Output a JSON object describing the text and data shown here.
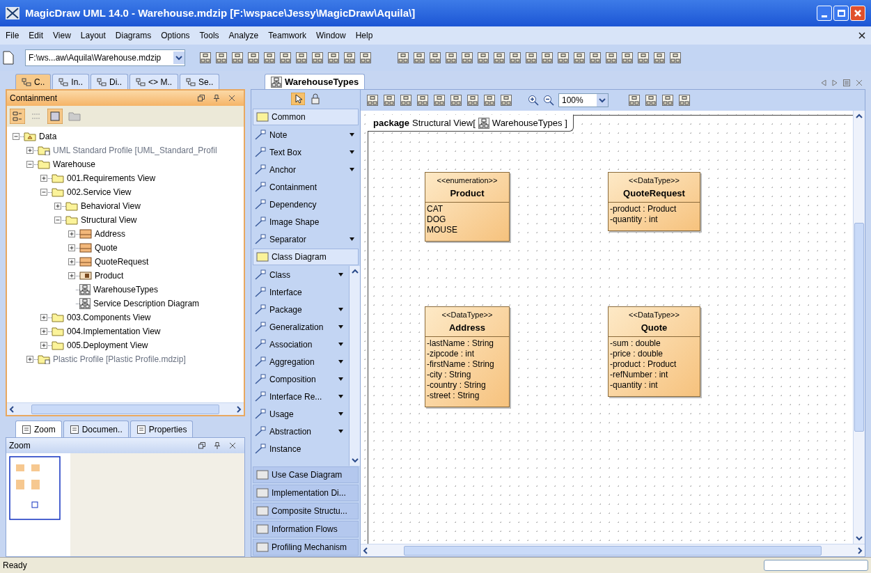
{
  "window": {
    "title": "MagicDraw UML 14.0 - Warehouse.mdzip [F:\\wspace\\Jessy\\MagicDraw\\Aquila\\]"
  },
  "menu": [
    "File",
    "Edit",
    "View",
    "Layout",
    "Diagrams",
    "Options",
    "Tools",
    "Analyze",
    "Teamwork",
    "Window",
    "Help"
  ],
  "toolbar": {
    "project_path": "F:\\ws...aw\\Aquila\\Warehouse.mdzip"
  },
  "browser_tabs": [
    {
      "label": "C..",
      "selected": true
    },
    {
      "label": "In..",
      "selected": false
    },
    {
      "label": "Di..",
      "selected": false
    },
    {
      "label": "<> M..",
      "selected": false
    },
    {
      "label": "Se..",
      "selected": false
    }
  ],
  "containment": {
    "title": "Containment",
    "tree": [
      {
        "label": "Data",
        "kind": "model",
        "expanded": true,
        "children": [
          {
            "label": "UML Standard Profile [UML_Standard_Profil",
            "kind": "profile",
            "expanded": false
          },
          {
            "label": "Warehouse",
            "kind": "folder",
            "expanded": true,
            "children": [
              {
                "label": "001.Requirements View",
                "kind": "folder",
                "expanded": false
              },
              {
                "label": "002.Service View",
                "kind": "folder",
                "expanded": true,
                "children": [
                  {
                    "label": "Behavioral View",
                    "kind": "folder",
                    "expanded": false
                  },
                  {
                    "label": "Structural View",
                    "kind": "folder",
                    "expanded": true,
                    "children": [
                      {
                        "label": "Address",
                        "kind": "class",
                        "expanded": false
                      },
                      {
                        "label": "Quote",
                        "kind": "class",
                        "expanded": false
                      },
                      {
                        "label": "QuoteRequest",
                        "kind": "class",
                        "expanded": false
                      },
                      {
                        "label": "Product",
                        "kind": "enumeration",
                        "expanded": false
                      },
                      {
                        "label": "WarehouseTypes",
                        "kind": "diagram"
                      },
                      {
                        "label": "Service Description Diagram",
                        "kind": "diagram"
                      }
                    ]
                  }
                ]
              },
              {
                "label": "003.Components View",
                "kind": "folder",
                "expanded": false
              },
              {
                "label": "004.Implementation View",
                "kind": "folder",
                "expanded": false
              },
              {
                "label": "005.Deployment View",
                "kind": "folder",
                "expanded": false
              }
            ]
          },
          {
            "label": "Plastic Profile [Plastic Profile.mdzip]",
            "kind": "profile",
            "expanded": false
          }
        ]
      }
    ]
  },
  "lower_tabs": [
    {
      "label": "Zoom",
      "selected": true
    },
    {
      "label": "Documen..",
      "selected": false
    },
    {
      "label": "Properties",
      "selected": false
    }
  ],
  "zoom_panel": {
    "title": "Zoom"
  },
  "diagram_tabs": [
    {
      "label": "WarehouseTypes",
      "selected": true
    }
  ],
  "zoom_level": "100%",
  "palette": [
    {
      "title": "Common",
      "expanded": true,
      "items": [
        {
          "label": "Note",
          "menu": true
        },
        {
          "label": "Text Box",
          "menu": true
        },
        {
          "label": "Anchor",
          "menu": true
        },
        {
          "label": "Containment",
          "menu": false
        },
        {
          "label": "Dependency",
          "menu": false
        },
        {
          "label": "Image Shape",
          "menu": false
        },
        {
          "label": "Separator",
          "menu": true
        }
      ]
    },
    {
      "title": "Class Diagram",
      "expanded": true,
      "items": [
        {
          "label": "Class",
          "menu": true
        },
        {
          "label": "Interface",
          "menu": false
        },
        {
          "label": "Package",
          "menu": true
        },
        {
          "label": "Generalization",
          "menu": true
        },
        {
          "label": "Association",
          "menu": true
        },
        {
          "label": "Aggregation",
          "menu": true
        },
        {
          "label": "Composition",
          "menu": true
        },
        {
          "label": "Interface Re...",
          "menu": true
        },
        {
          "label": "Usage",
          "menu": true
        },
        {
          "label": "Abstraction",
          "menu": true
        },
        {
          "label": "Instance",
          "menu": false
        }
      ]
    },
    {
      "title": "Use Case Diagram",
      "expanded": false
    },
    {
      "title": "Implementation Di...",
      "expanded": false
    },
    {
      "title": "Composite Structu...",
      "expanded": false
    },
    {
      "title": "Information Flows",
      "expanded": false
    },
    {
      "title": "Profiling Mechanism",
      "expanded": false
    }
  ],
  "diagram": {
    "frame": {
      "keyword": "package",
      "name": "Structural View[",
      "diagram": "WarehouseTypes ]"
    },
    "classes": [
      {
        "stereotype": "<<enumeration>>",
        "name": "Product",
        "members": [
          "CAT",
          "DOG",
          "MOUSE"
        ]
      },
      {
        "stereotype": "<<DataType>>",
        "name": "QuoteRequest",
        "members": [
          "-product : Product",
          "-quantity : int"
        ]
      },
      {
        "stereotype": "<<DataType>>",
        "name": "Address",
        "members": [
          "-lastName : String",
          "-zipcode : int",
          "-firstName : String",
          "-city : String",
          "-country : String",
          "-street : String"
        ]
      },
      {
        "stereotype": "<<DataType>>",
        "name": "Quote",
        "members": [
          "-sum : double",
          "-price : double",
          "-product : Product",
          "-refNumber : int",
          "-quantity : int"
        ]
      }
    ]
  },
  "status_bar": {
    "text": "Ready"
  }
}
